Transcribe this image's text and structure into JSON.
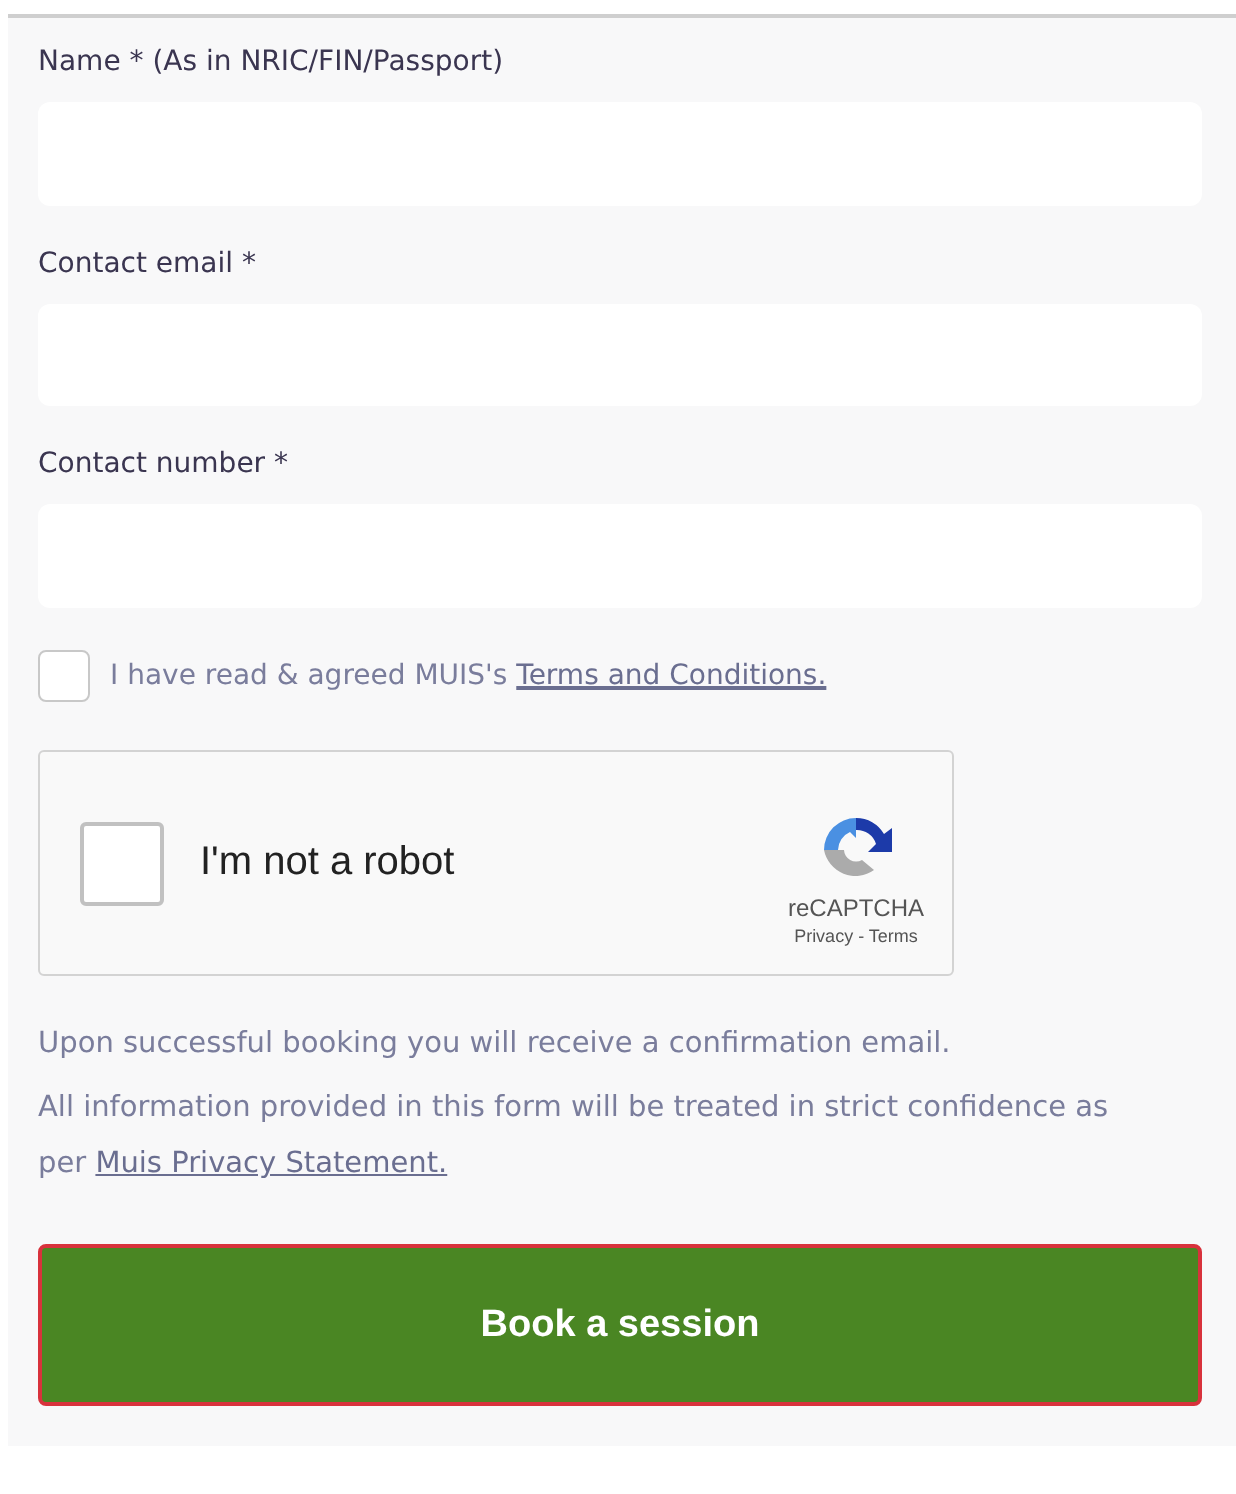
{
  "fields": [
    {
      "label": "Name * (As in NRIC/FIN/Passport)"
    },
    {
      "label": "Contact email *"
    },
    {
      "label": "Contact number *"
    }
  ],
  "terms": {
    "text": "I have read & agreed MUIS's",
    "link": "Terms and Conditions.",
    "checked": false
  },
  "captcha": {
    "label": "I'm not a robot",
    "checked": false,
    "brand": "reCAPTCHA",
    "links": "Privacy - Terms"
  },
  "notes": [
    {
      "text": "Upon successful booking you will receive a confirmation email."
    },
    {
      "text": "All information provided in this form will be treated in strict confidence as per",
      "link": "Muis Privacy Statement."
    }
  ],
  "button": "Book a session"
}
